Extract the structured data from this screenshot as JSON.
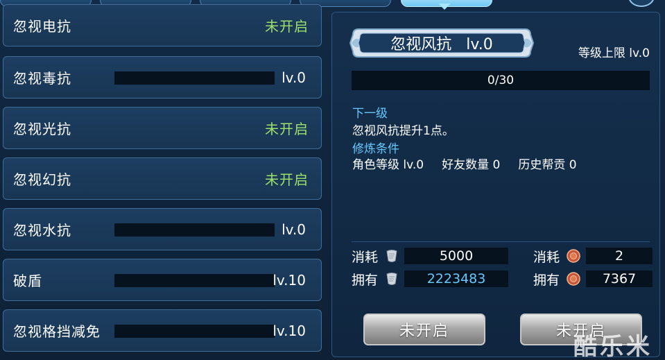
{
  "left_list": [
    {
      "label": "忽视电抗",
      "state": "未开启",
      "level": null
    },
    {
      "label": "忽视毒抗",
      "state": null,
      "level": "lv.0"
    },
    {
      "label": "忽视光抗",
      "state": "未开启",
      "level": null
    },
    {
      "label": "忽视幻抗",
      "state": "未开启",
      "level": null
    },
    {
      "label": "忽视水抗",
      "state": null,
      "level": "lv.0"
    },
    {
      "label": "破盾",
      "state": null,
      "level": "lv.10"
    },
    {
      "label": "忽视格挡减免",
      "state": null,
      "level": "lv.10"
    }
  ],
  "detail": {
    "title": "忽视风抗   lv.0",
    "level_cap": "等级上限 lv.0",
    "progress_text": "0/30",
    "progress_fraction": 0.0,
    "next_label": "下一级",
    "next_desc": "忽视风抗提升1点。",
    "condition_label": "修炼条件",
    "conditions": [
      "角色等级 lv.0",
      "好友数量 0",
      "历史帮贡 0"
    ]
  },
  "costs": {
    "consume_label": "消耗",
    "own_label": "拥有",
    "scroll_cost": "5000",
    "scroll_own": "2223483",
    "token_cost": "2",
    "token_own": "7367"
  },
  "buttons": {
    "left": "未开启",
    "right": "未开启"
  },
  "watermark": "酷乐米",
  "colors": {
    "locked_text": "#9ee06a",
    "accent_blue": "#66c8ff"
  }
}
